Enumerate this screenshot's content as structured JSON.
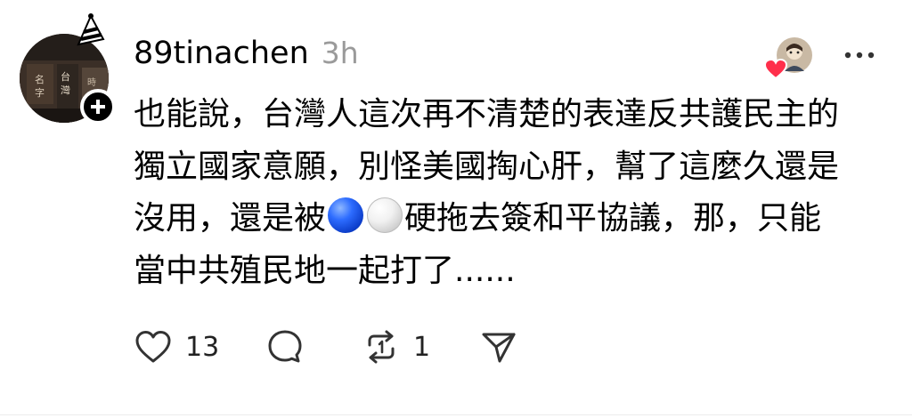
{
  "post": {
    "username": "89tinachen",
    "timestamp": "3h",
    "text_lines": [
      [
        "也能說，台灣人這次再不清楚的表達反共護民主的"
      ],
      [
        "獨立國家意願，別怪美國掏心肝，幫了這麼久還是"
      ],
      [
        "沒用，還是被",
        "硬拖去簽和平協議，那，只能"
      ],
      [
        "當中共殖民地一起打了......"
      ]
    ],
    "emoji": [
      "blue-ball-emoji",
      "white-ball-emoji"
    ]
  },
  "actions": {
    "like_count": "13",
    "repost_count": "1"
  },
  "icons": {
    "like": "heart-icon",
    "comment": "comment-icon",
    "repost": "repost-icon",
    "share": "send-icon",
    "more": "more-icon",
    "follow": "plus-icon",
    "liked_badge": "red-heart-icon"
  },
  "colors": {
    "text": "#000000",
    "muted": "#9a9a9a",
    "like_red": "#ff2f4b"
  }
}
